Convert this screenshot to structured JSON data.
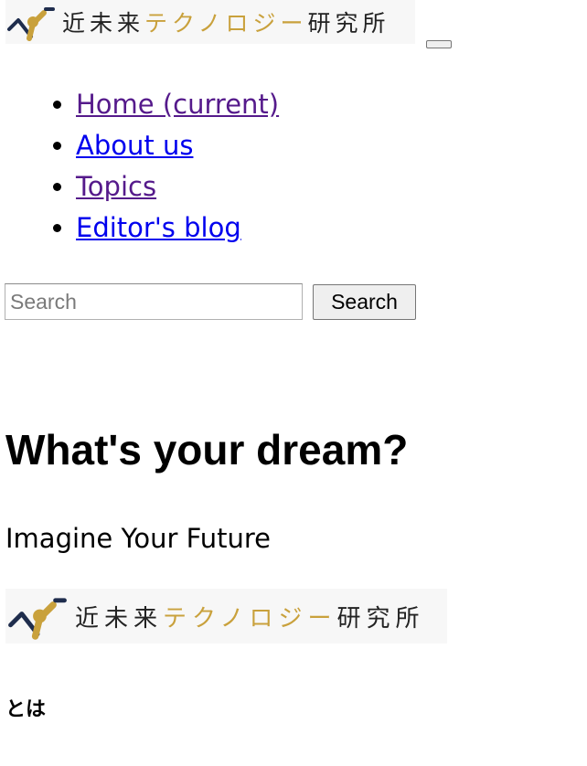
{
  "header": {
    "logo": {
      "part_dark_1": "近未来",
      "part_gold": "テクノロジー",
      "part_dark_2": "研究所"
    },
    "colors": {
      "logo_gold": "#c9a13c",
      "logo_dark": "#222222"
    }
  },
  "nav": {
    "items": [
      {
        "label": "Home (current)"
      },
      {
        "label": "About us"
      },
      {
        "label": "Topics"
      },
      {
        "label": "Editor's blog"
      }
    ]
  },
  "search": {
    "placeholder": "Search",
    "button_label": "Search"
  },
  "hero": {
    "headline": "What's your dream?",
    "lead": "Imagine Your Future"
  },
  "about": {
    "heading": "とは"
  }
}
